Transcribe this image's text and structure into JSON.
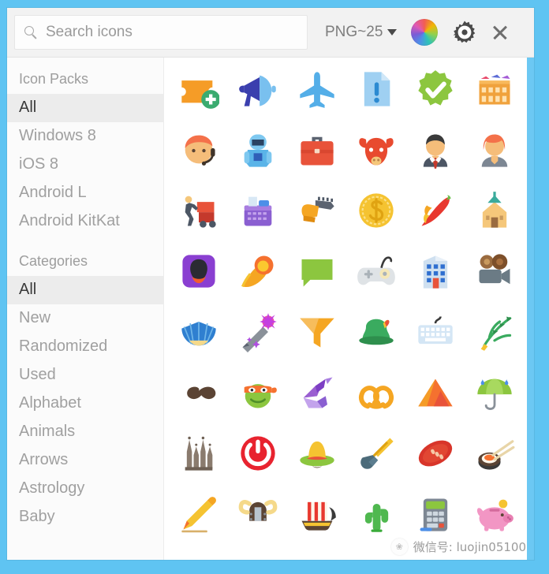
{
  "window": {
    "background_color": "#5fc4f2",
    "surface_color": "#ffffff"
  },
  "toolbar": {
    "search": {
      "placeholder": "Search icons",
      "value": "",
      "icon": "search-icon"
    },
    "format_label": "PNG~25",
    "format_caret_icon": "chevron-down-icon",
    "color_wheel_icon": "color-wheel-icon",
    "settings_icon": "gear-icon",
    "close_icon": "close-icon"
  },
  "sidebar": {
    "groups": [
      {
        "title": "Icon Packs",
        "items": [
          {
            "label": "All",
            "selected": true
          },
          {
            "label": "Windows 8",
            "selected": false
          },
          {
            "label": "iOS 8",
            "selected": false
          },
          {
            "label": "Android L",
            "selected": false
          },
          {
            "label": "Android KitKat",
            "selected": false
          }
        ]
      },
      {
        "title": "Categories",
        "items": [
          {
            "label": "All",
            "selected": true
          },
          {
            "label": "New",
            "selected": false
          },
          {
            "label": "Randomized",
            "selected": false
          },
          {
            "label": "Used",
            "selected": false
          },
          {
            "label": "Alphabet",
            "selected": false
          },
          {
            "label": "Animals",
            "selected": false
          },
          {
            "label": "Arrows",
            "selected": false
          },
          {
            "label": "Astrology",
            "selected": false
          },
          {
            "label": "Baby",
            "selected": false
          }
        ]
      }
    ]
  },
  "grid": {
    "columns": 6,
    "icons": [
      {
        "name": "ticket-add-icon",
        "label": "Add Ticket"
      },
      {
        "name": "megaphone-icon",
        "label": "Megaphone"
      },
      {
        "name": "airplane-icon",
        "label": "Airplane"
      },
      {
        "name": "document-alert-icon",
        "label": "Alert Document"
      },
      {
        "name": "verified-badge-icon",
        "label": "Approval"
      },
      {
        "name": "colosseum-icon",
        "label": "Colosseum"
      },
      {
        "name": "support-agent-icon",
        "label": "Support Agent"
      },
      {
        "name": "astronaut-icon",
        "label": "Astronaut"
      },
      {
        "name": "briefcase-icon",
        "label": "Briefcase"
      },
      {
        "name": "bull-icon",
        "label": "Bull"
      },
      {
        "name": "businessman-icon",
        "label": "Businessman"
      },
      {
        "name": "businesswoman-icon",
        "label": "Businesswoman"
      },
      {
        "name": "car-push-icon",
        "label": "Car Push"
      },
      {
        "name": "cash-register-icon",
        "label": "Cash Register"
      },
      {
        "name": "chainsaw-icon",
        "label": "Chainsaw"
      },
      {
        "name": "dollar-coin-icon",
        "label": "Dollar Coin"
      },
      {
        "name": "chili-pepper-icon",
        "label": "Chili Pepper"
      },
      {
        "name": "church-icon",
        "label": "Church"
      },
      {
        "name": "cinema-mask-icon",
        "label": "Cinema"
      },
      {
        "name": "comet-icon",
        "label": "Comet"
      },
      {
        "name": "speech-bubble-icon",
        "label": "Comments"
      },
      {
        "name": "game-controller-icon",
        "label": "Controller"
      },
      {
        "name": "office-building-icon",
        "label": "Department Shop"
      },
      {
        "name": "movie-camera-icon",
        "label": "Movie Camera"
      },
      {
        "name": "folding-fan-icon",
        "label": "Folding Fan"
      },
      {
        "name": "magic-wand-icon",
        "label": "Magic Wand"
      },
      {
        "name": "funnel-icon",
        "label": "Filter"
      },
      {
        "name": "tyrolean-hat-icon",
        "label": "Tyrolean Hat"
      },
      {
        "name": "keyboard-icon",
        "label": "Keyboard"
      },
      {
        "name": "palm-leaf-icon",
        "label": "Palm Leaf"
      },
      {
        "name": "moustache-icon",
        "label": "Moustache"
      },
      {
        "name": "ninja-turtle-icon",
        "label": "Ninja Turtle"
      },
      {
        "name": "origami-swan-icon",
        "label": "Origami"
      },
      {
        "name": "pretzel-icon",
        "label": "Pretzel"
      },
      {
        "name": "pyramid-icon",
        "label": "Pyramid"
      },
      {
        "name": "umbrella-rain-icon",
        "label": "Rain"
      },
      {
        "name": "sagrada-familia-icon",
        "label": "Sagrada Familia"
      },
      {
        "name": "power-button-icon",
        "label": "Shutdown"
      },
      {
        "name": "sombrero-icon",
        "label": "Sombrero"
      },
      {
        "name": "shovel-icon",
        "label": "Shovel"
      },
      {
        "name": "football-icon",
        "label": "Football"
      },
      {
        "name": "sushi-icon",
        "label": "Sushi"
      },
      {
        "name": "pencil-icon",
        "label": "Edit"
      },
      {
        "name": "viking-helmet-icon",
        "label": "Viking Helmet"
      },
      {
        "name": "viking-ship-icon",
        "label": "Viking Ship"
      },
      {
        "name": "cactus-icon",
        "label": "Cactus"
      },
      {
        "name": "card-terminal-icon",
        "label": "Card Terminal"
      },
      {
        "name": "piggy-bank-icon",
        "label": "Piggy Bank"
      }
    ]
  },
  "watermark": {
    "text": "微信号: luojin05100",
    "badge_glyph": "❀"
  }
}
